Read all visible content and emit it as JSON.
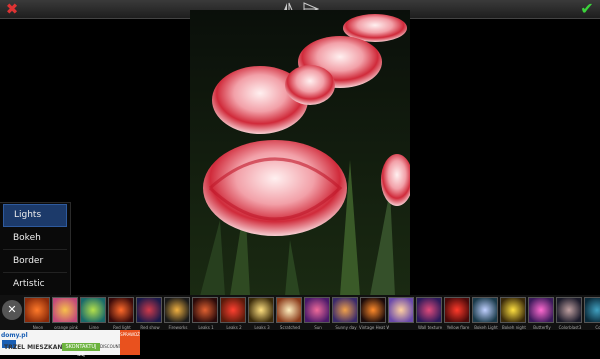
{
  "toolbar": {
    "cancel_icon": "close-x-icon",
    "flip_icon": "flip-icon",
    "rotate_icon": "rotate-icon",
    "confirm_icon": "checkmark-icon"
  },
  "menu": {
    "items": [
      "Lights",
      "Bokeh",
      "Border",
      "Artistic"
    ],
    "active": "Lights"
  },
  "effects": [
    {
      "label": "Neon",
      "c1": "#8a2a0a",
      "c2": "#ff7a2a"
    },
    {
      "label": "orange pink",
      "c1": "#c24a7a",
      "c2": "#f7c04a"
    },
    {
      "label": "Lime",
      "c1": "#1a6a6a",
      "c2": "#b4e04a"
    },
    {
      "label": "Red light",
      "c1": "#3a0a0a",
      "c2": "#ff6a2a"
    },
    {
      "label": "Red show",
      "c1": "#1a1a4a",
      "c2": "#d03a4a"
    },
    {
      "label": "Fireworks",
      "c1": "#1a1a1a",
      "c2": "#f0b040"
    },
    {
      "label": "Leaks 1",
      "c1": "#2a0a0a",
      "c2": "#e06030"
    },
    {
      "label": "Leaks 2",
      "c1": "#5a1a0a",
      "c2": "#ff4030"
    },
    {
      "label": "Leaks 3",
      "c1": "#3a2a0a",
      "c2": "#ffe080"
    },
    {
      "label": "Scratched",
      "c1": "#8a3a1a",
      "c2": "#fff0c0"
    },
    {
      "label": "Sun",
      "c1": "#4a1a6a",
      "c2": "#f06a9a"
    },
    {
      "label": "Sunny day",
      "c1": "#3a2a6a",
      "c2": "#f0a04a"
    },
    {
      "label": "Vintage Heat Wall",
      "c1": "#1a0a0a",
      "c2": "#ff8a2a"
    },
    {
      "label": "",
      "c1": "#6a4aaa",
      "c2": "#ffd0a0"
    },
    {
      "label": "Wall texture",
      "c1": "#2a1a5a",
      "c2": "#e04a7a"
    },
    {
      "label": "Yellow flare",
      "c1": "#4a0a0a",
      "c2": "#ff3a2a"
    },
    {
      "label": "Bokeh Light",
      "c1": "#1a3a4a",
      "c2": "#c0d0ff"
    },
    {
      "label": "Bokeh night",
      "c1": "#3a2a0a",
      "c2": "#ffe040"
    },
    {
      "label": "Butterfly",
      "c1": "#3a1a5a",
      "c2": "#ff6ad0"
    },
    {
      "label": "Colorblast3",
      "c1": "#1a1a2a",
      "c2": "#c0a0a0"
    },
    {
      "label": "Co",
      "c1": "#0a2a3a",
      "c2": "#40a0c0"
    }
  ],
  "ad": {
    "brand": "domy.pl",
    "headline": "TRZEL MIESZKANIE",
    "badge": "SKONTAKTUJ SIĘ",
    "discount": "DISCOUNT",
    "cta": "SPRAWDŹ"
  }
}
